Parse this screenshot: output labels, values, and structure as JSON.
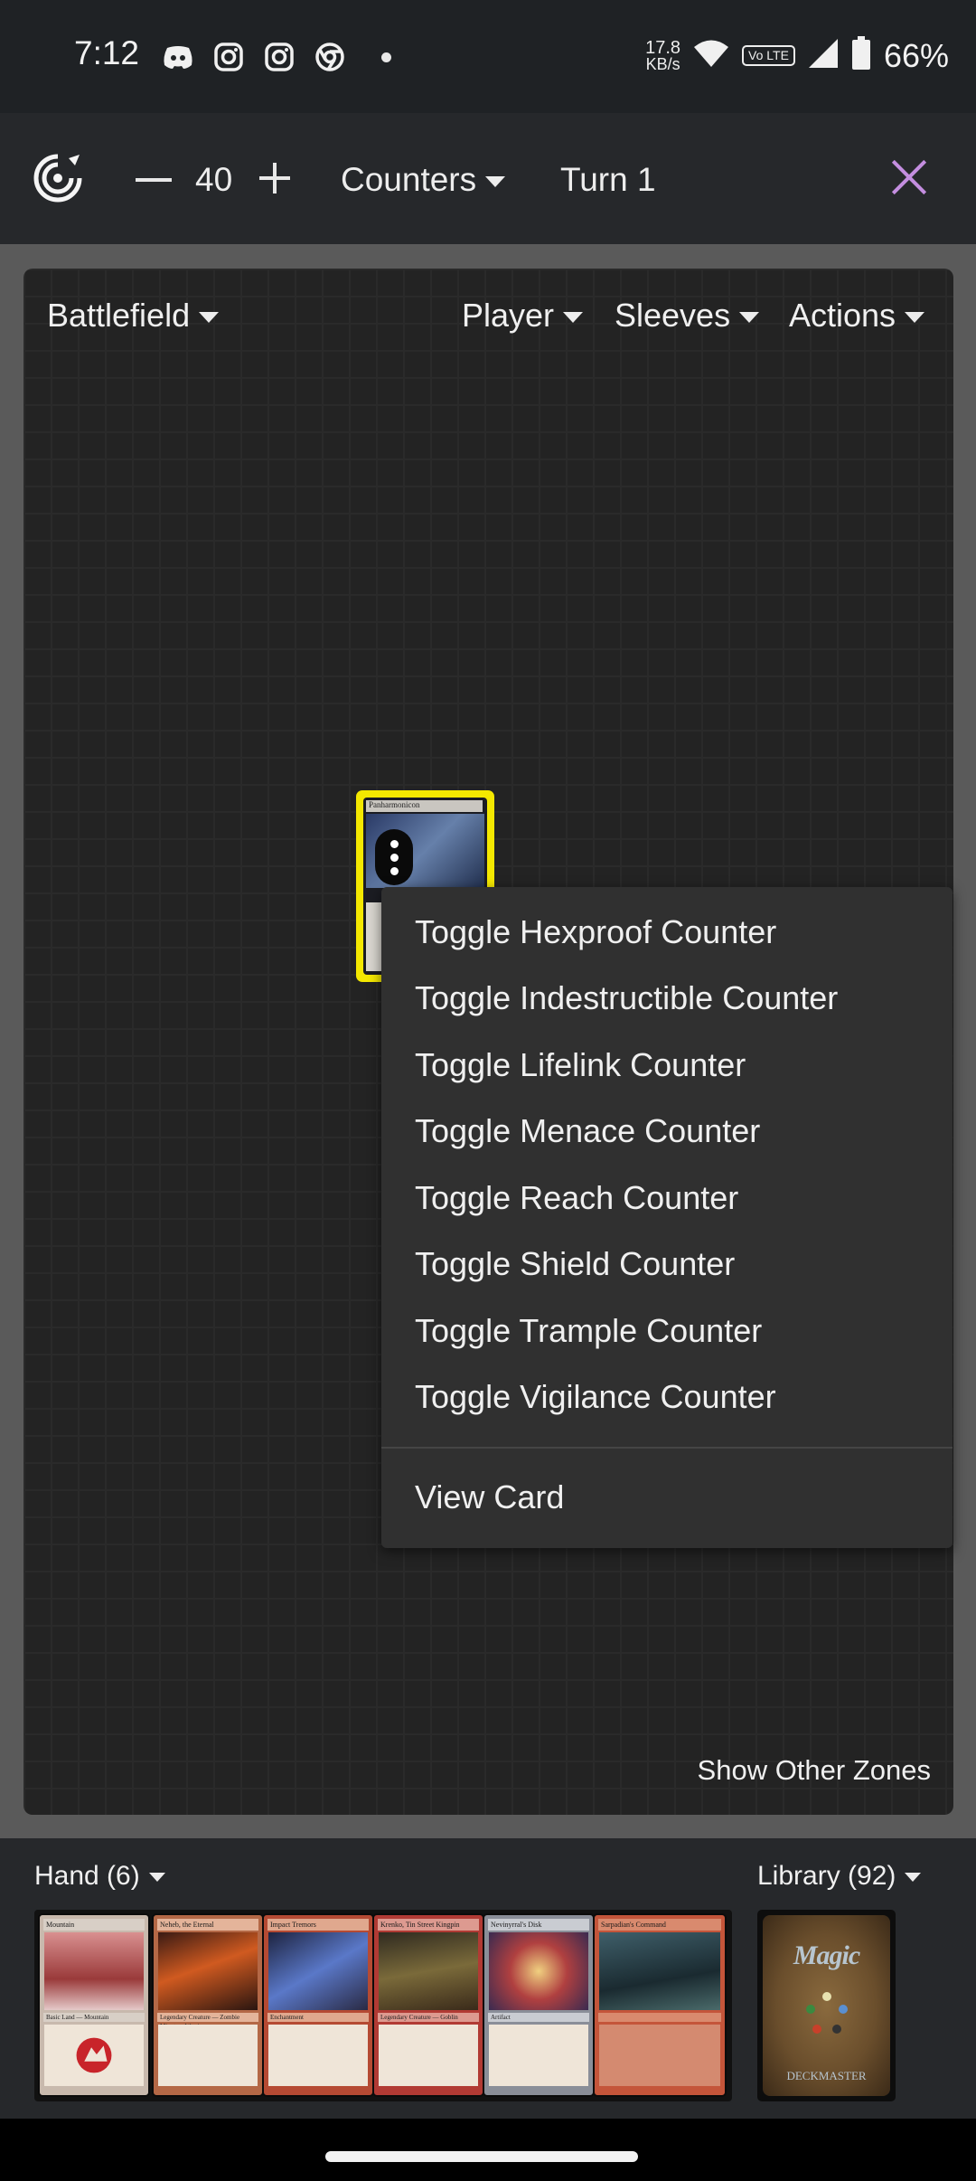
{
  "status_bar": {
    "time": "7:12",
    "left_icons": [
      "discord-icon",
      "instagram-icon",
      "instagram-icon",
      "chrome-icon",
      "notification-dot-icon"
    ],
    "speed_value": "17.8",
    "speed_unit": "KB/s",
    "volte": "Vo LTE",
    "battery_percent": "66%"
  },
  "toolbar": {
    "logo_icon": "app-logo-icon",
    "life_total": "40",
    "counters_label": "Counters",
    "turn_label": "Turn 1",
    "close_icon": "close-icon",
    "close_color": "#c48ee0"
  },
  "battlefield": {
    "zone_label": "Battlefield",
    "player_label": "Player",
    "sleeves_label": "Sleeves",
    "actions_label": "Actions",
    "card": {
      "name": "Panharmonicon",
      "highlight_color": "#f4e800"
    },
    "show_other_zones": "Show Other Zones"
  },
  "context_menu": {
    "items": [
      "Toggle Hexproof Counter",
      "Toggle Indestructible Counter",
      "Toggle Lifelink Counter",
      "Toggle Menace Counter",
      "Toggle Reach Counter",
      "Toggle Shield Counter",
      "Toggle Trample Counter",
      "Toggle Vigilance Counter"
    ],
    "view_card": "View Card"
  },
  "hand": {
    "label": "Hand (6)",
    "cards": [
      {
        "name": "Mountain",
        "type": "Basic Land — Mountain"
      },
      {
        "name": "Neheb, the Eternal",
        "type": "Legendary Creature — Zombie Minotaur Warrior"
      },
      {
        "name": "Impact Tremors",
        "type": "Enchantment"
      },
      {
        "name": "Krenko, Tin Street Kingpin",
        "type": "Legendary Creature — Goblin"
      },
      {
        "name": "Nevinyrral's Disk",
        "type": "Artifact"
      },
      {
        "name": "Sarpadian's Command",
        "type": ""
      }
    ]
  },
  "library": {
    "label": "Library (92)",
    "card_back_text": "Magic",
    "card_back_subtext": "DECKMASTER"
  }
}
